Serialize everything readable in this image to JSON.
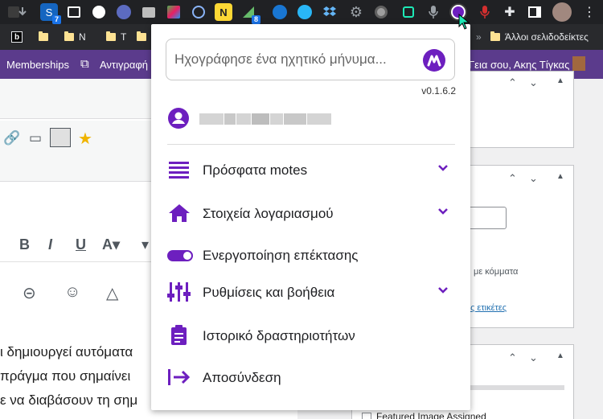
{
  "extensions_bar": {
    "badge_7": "7",
    "badge_8": "8",
    "items": [
      "blank-icon",
      "download-icon",
      "s-icon",
      "screen-icon",
      "circle-s-icon",
      "s-purple-icon",
      "briefcase-icon",
      "chart-icon",
      "wordpress-icon",
      "n-yellow-icon",
      "triangle-icon",
      "audio-icon",
      "skype-icon",
      "dropbox-icon",
      "gear-icon",
      "record-icon",
      "screen-green-icon",
      "mic-icon",
      "motes-icon",
      "mic-red-icon",
      "puzzle-icon",
      "sidebar-icon",
      "profile-avatar"
    ]
  },
  "bookmarks_bar": {
    "items": [
      "",
      "",
      "N",
      "T"
    ],
    "other_bookmarks": "Άλλοι σελιδοδείκτες"
  },
  "wp_admin_bar": {
    "memberships": "Memberships",
    "copy": "Αντιγραφή",
    "greeting": "Γεια σου, Ακης Τίγκας"
  },
  "editor": {
    "body_lines": [
      "ι δημιουργεί αυτόματα",
      " πράγμα που σημαίνει",
      "ε να διαβάσουν τη σημ"
    ]
  },
  "sidebar": {
    "tags_hint": "με κόμματα",
    "tags_link": "ερες ετικέτες",
    "featured_label": "Featured Image Assigned"
  },
  "popup": {
    "search_placeholder": "Ηχογράφησε ένα ηχητικό μήνυμα...",
    "version": "v0.1.6.2",
    "menu": {
      "recent": "Πρόσφατα motes",
      "account": "Στοιχεία λογαριασμού",
      "enable": "Ενεργοποίηση επέκτασης",
      "settings": "Ρυθμίσεις και βοήθεια",
      "history": "Ιστορικό δραστηριοτήτων",
      "logout": "Αποσύνδεση"
    }
  },
  "colors": {
    "accent": "#6d1fbf",
    "admin_bar": "#5b3b8c",
    "browser_dark": "#202124"
  }
}
